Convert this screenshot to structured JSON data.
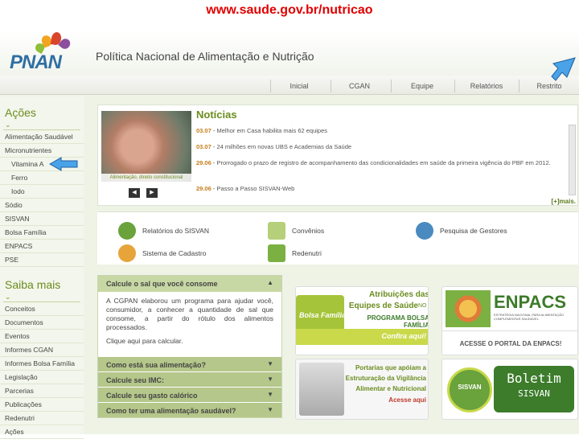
{
  "url_caption": "www.saude.gov.br/nutricao",
  "logo": {
    "text": "PNAN"
  },
  "site_title": "Política Nacional de Alimentação e Nutrição",
  "nav": {
    "tabs": [
      "Inicial",
      "CGAN",
      "Equipe",
      "Relatórios",
      "Restrito"
    ]
  },
  "sidebar": {
    "acoes_heading": "Ações",
    "acoes_items": [
      {
        "label": "Alimentação Saudável",
        "sub": false
      },
      {
        "label": "Micronutrientes",
        "sub": false
      },
      {
        "label": "Vitamina A",
        "sub": true
      },
      {
        "label": "Ferro",
        "sub": true
      },
      {
        "label": "Iodo",
        "sub": true
      },
      {
        "label": "Sódio",
        "sub": false
      },
      {
        "label": "SISVAN",
        "sub": false
      },
      {
        "label": "Bolsa Família",
        "sub": false
      },
      {
        "label": "ENPACS",
        "sub": false
      },
      {
        "label": "PSE",
        "sub": false
      }
    ],
    "saiba_heading": "Saiba mais",
    "saiba_items": [
      "Conceitos",
      "Documentos",
      "Eventos",
      "Informes CGAN",
      "Informes Bolsa Família",
      "Legislação",
      "Parcerias",
      "Publicações",
      "Redenutri",
      "Ações"
    ]
  },
  "news": {
    "title": "Notícias",
    "image_caption": "Alimentação, direito constitucional",
    "prev": "◀",
    "next": "▶",
    "items": [
      {
        "date": "03.07",
        "text": " - Melhor em Casa habilita mais 62 equipes"
      },
      {
        "date": "03.07",
        "text": " - 24 milhões em novas UBS e Academias da Saúde"
      },
      {
        "date": "29.06",
        "text": " - Prorrogado o prazo de registro de acompanhamento das condicionalidades em saúde da primeira vigência do PBF em 2012."
      },
      {
        "date": "29.06",
        "text": " - Passo a Passo SISVAN-Web"
      }
    ],
    "more": "[+]mais."
  },
  "quick_links": [
    {
      "label": "Relatórios do SISVAN",
      "icon": "globe-icon",
      "color": "#6aa23c"
    },
    {
      "label": "Convênios",
      "icon": "document-icon",
      "color": "#b6cf7a"
    },
    {
      "label": "Pesquisa de Gestores",
      "icon": "people-icon",
      "color": "#4a8ac0"
    },
    {
      "label": "Sistema de Cadastro",
      "icon": "person-icon",
      "color": "#e6a43a"
    },
    {
      "label": "Redenutri",
      "icon": "network-icon",
      "color": "#7bb043"
    }
  ],
  "calc": {
    "heading": "Calcule o sal que você consome",
    "body": "A CGPAN elaborou um programa para ajudar você, consumidor, a conhecer a quantidade de sal que consome, a partir do rótulo dos alimentos processados.",
    "link": "Clique aqui para calcular.",
    "rows": [
      "Como está sua alimentação?",
      "Calcule seu IMC:",
      "Calcule seu gasto calórico",
      "Como ter uma alimentação saudável?"
    ]
  },
  "banners": {
    "b1": {
      "line1": "Atribuições das",
      "line2": "Equipes de Saúde",
      "line3": "NO",
      "line4": "PROGRAMA BOLSA FAMÍLIA",
      "line5": "Confira aqui!",
      "brand": "Bolsa Família"
    },
    "b2": {
      "title": "ENPACS",
      "sub": "ESTRATÉGIA NACIONAL PARA ALIMENTAÇÃO COMPLEMENTAR SAUDÁVEL",
      "cta": "ACESSE O PORTAL DA ENPACS!"
    },
    "b3": {
      "line1": "Portarias que apóiam a",
      "line2": "Estruturação da Vigilância",
      "line3": "Alimentar e Nutricional",
      "cta": "Acesse aqui"
    },
    "b4": {
      "title": "Boletim",
      "sub": "SISVAN",
      "seal": "SISVAN"
    }
  }
}
